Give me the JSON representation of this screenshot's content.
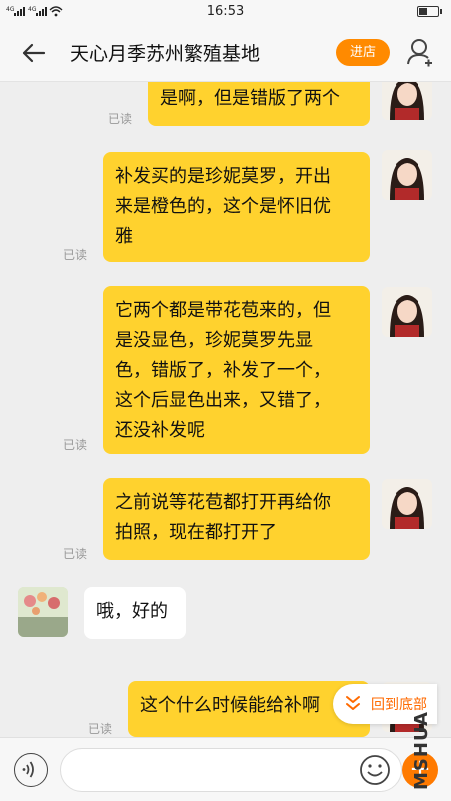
{
  "status_bar": {
    "signal": "⁴ᴳ∙∙∙∙⁵ᴳ∙∙∙",
    "time": "16:53",
    "battery_level": 0.45
  },
  "header": {
    "title": "天心月季苏州繁殖基地",
    "enter_shop_label": "进店"
  },
  "messages": [
    {
      "from": "me",
      "lines": [
        "是啊，但是错版了两个"
      ],
      "read_label": "已读"
    },
    {
      "from": "me",
      "lines": [
        "补发买的是珍妮莫罗，开出",
        "来是橙色的，这个是怀旧优",
        "雅"
      ],
      "read_label": "已读"
    },
    {
      "from": "me",
      "lines": [
        "它两个都是带花苞来的，但",
        "是没显色，珍妮莫罗先显",
        "色，错版了，补发了一个，",
        "这个后显色出来，又错了，",
        "还没补发呢"
      ],
      "read_label": "已读"
    },
    {
      "from": "me",
      "lines": [
        "之前说等花苞都打开再给你",
        "拍照，现在都打开了"
      ],
      "read_label": "已读"
    },
    {
      "from": "other",
      "lines": [
        "哦，好的"
      ]
    },
    {
      "from": "me",
      "lines": [
        "这个什么时候能给补啊"
      ],
      "read_label": "已读"
    }
  ],
  "scroll_bottom_label": "回到底部",
  "watermark": "MSHUA",
  "input": {
    "placeholder": "",
    "plus_label": "+"
  },
  "colors": {
    "accent": "#ff8a00",
    "bubble_out": "#ffd22e",
    "bubble_in": "#ffffff",
    "background": "#eeeeee"
  },
  "icons": [
    "back-arrow-icon",
    "user-icon",
    "voice-icon",
    "emoji-icon",
    "plus-icon",
    "chevron-double-down-icon"
  ]
}
